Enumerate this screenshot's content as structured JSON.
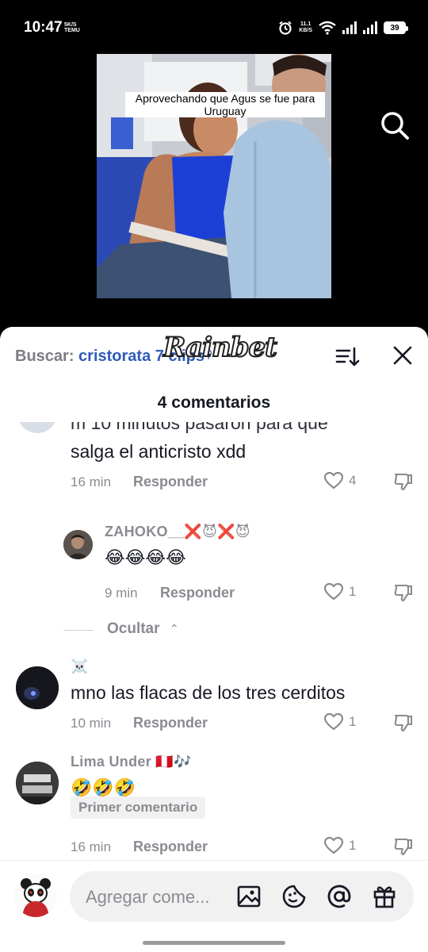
{
  "status_bar": {
    "time": "10:47",
    "left_speed_top": "5K/S",
    "left_speed_bottom": "TEMU",
    "net_speed_top": "11.1",
    "net_speed_bottom": "KB/S",
    "battery": "39"
  },
  "video": {
    "caption": "Aprovechando que Agus se fue para Uruguay",
    "watermark": "Rainbet",
    "search_icon": "search-icon"
  },
  "sheet": {
    "search_prefix": "Buscar:",
    "search_query": "cristorata 7 clips",
    "comment_count": "4 comentarios"
  },
  "comments": [
    {
      "text_line1": "m 10 minutos pasaron para que",
      "text_line2": "salga el anticristo xdd",
      "time": "16 min",
      "reply_label": "Responder",
      "likes": "4"
    },
    {
      "username": "ZAHOKO__❌😈❌😈",
      "text": "😂😂😂😂",
      "time": "9 min",
      "reply_label": "Responder",
      "likes": "1"
    },
    {
      "username": "☠️",
      "text": "mno las flacas de los tres cerditos",
      "time": "10 min",
      "reply_label": "Responder",
      "likes": "1"
    },
    {
      "username": "Lima Under 🇵🇪🎶",
      "text": "🤣🤣🤣",
      "badge": "Primer comentario",
      "time": "16 min",
      "reply_label": "Responder",
      "likes": "1"
    }
  ],
  "hide_replies": "Ocultar",
  "input": {
    "placeholder": "Agregar come..."
  },
  "colors": {
    "accent_blue": "#2f5bb8",
    "muted_gray": "#8a8b91",
    "text_dark": "#161823"
  }
}
